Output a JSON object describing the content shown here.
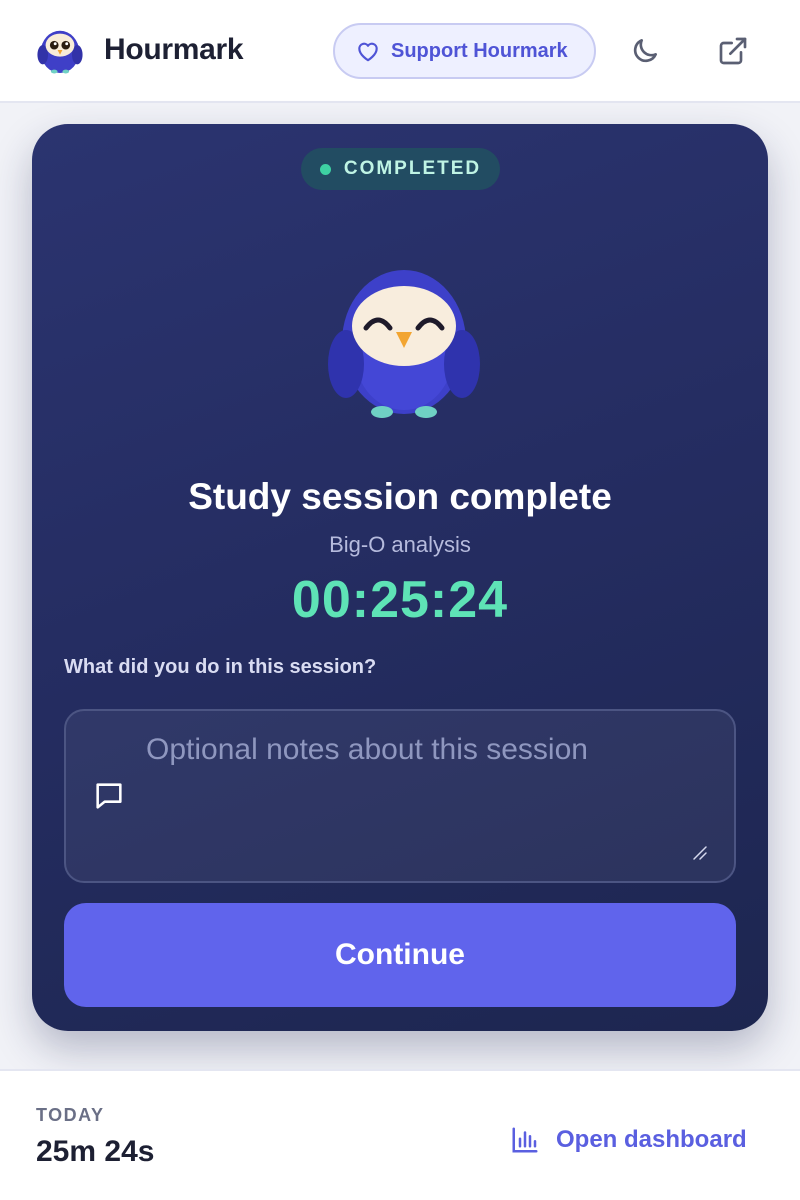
{
  "header": {
    "app_name": "Hourmark",
    "support_label": "Support Hourmark",
    "icons": [
      "owl-logo-icon",
      "heart-icon",
      "moon-icon",
      "external-link-icon"
    ]
  },
  "session": {
    "status": "COMPLETED",
    "title": "Study session complete",
    "subject": "Big-O analysis",
    "elapsed": "00:25:24",
    "notes_question": "What did you do in this session?",
    "notes_placeholder": "Optional notes about this session",
    "notes_value": "",
    "continue_label": "Continue"
  },
  "footer": {
    "today_label": "TODAY",
    "today_value": "25m 24s",
    "dashboard_label": "Open dashboard",
    "dashboard_icon": "bar-chart-icon"
  },
  "colors": {
    "accent": "#6064ec",
    "timer": "#5ee3b6",
    "card_bg": "#252d62",
    "status_dot": "#3ed1a2"
  }
}
